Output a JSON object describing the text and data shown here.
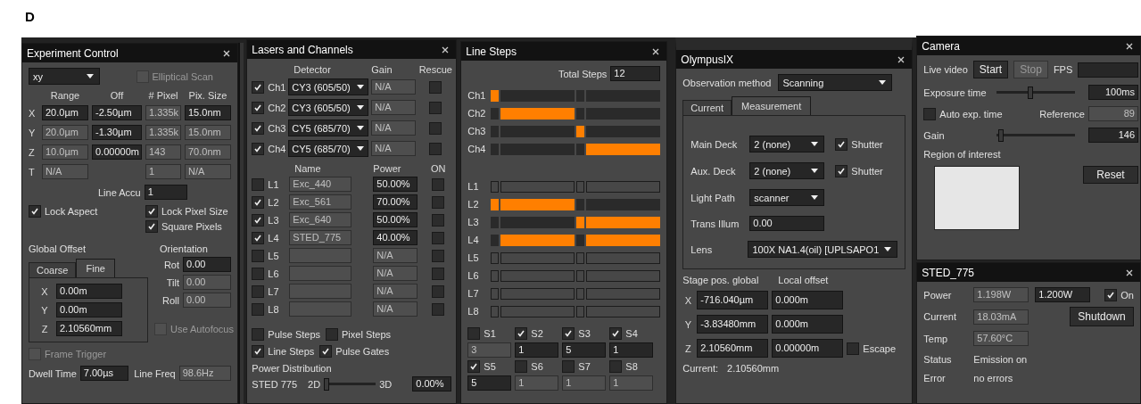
{
  "figure_label": "D",
  "experiment_control": {
    "title": "Experiment Control",
    "mode": "xy",
    "elliptical_scan": {
      "label": "Elliptical Scan",
      "checked": false,
      "disabled": true
    },
    "columns": [
      "Range",
      "Off",
      "# Pixel",
      "Pix. Size"
    ],
    "rows": [
      {
        "axis": "X",
        "cells": [
          {
            "value": "20.0µm",
            "disabled": false
          },
          {
            "value": "-2.50µm",
            "disabled": false
          },
          {
            "value": "1.335k",
            "disabled": true
          },
          {
            "value": "15.0nm",
            "disabled": false
          }
        ]
      },
      {
        "axis": "Y",
        "cells": [
          {
            "value": "20.0µm",
            "disabled": true
          },
          {
            "value": "-1.30µm",
            "disabled": false
          },
          {
            "value": "1.335k",
            "disabled": true
          },
          {
            "value": "15.0nm",
            "disabled": true
          }
        ]
      },
      {
        "axis": "Z",
        "cells": [
          {
            "value": "10.0µm",
            "disabled": true
          },
          {
            "value": "0.00000m",
            "disabled": false
          },
          {
            "value": "143",
            "disabled": true
          },
          {
            "value": "70.0nm",
            "disabled": true
          }
        ]
      },
      {
        "axis": "T",
        "cells": [
          {
            "value": "N/A",
            "disabled": true
          },
          null,
          {
            "value": "1",
            "disabled": true
          },
          {
            "value": "N/A",
            "disabled": true
          }
        ]
      }
    ],
    "line_accu": {
      "label": "Line Accu",
      "value": "1"
    },
    "lock_aspect": {
      "label": "Lock Aspect",
      "checked": true,
      "disabled": false
    },
    "lock_pixel_size": {
      "label": "Lock Pixel Size",
      "checked": true,
      "disabled": false
    },
    "square_pixels": {
      "label": "Square Pixels",
      "checked": true,
      "disabled": false
    },
    "global_offset": {
      "label": "Global Offset",
      "tabs": [
        {
          "label": "Coarse",
          "selected": false
        },
        {
          "label": "Fine",
          "selected": true
        }
      ],
      "rows": [
        {
          "axis": "X",
          "value": "0.00m"
        },
        {
          "axis": "Y",
          "value": "0.00m"
        },
        {
          "axis": "Z",
          "value": "2.10560mm"
        }
      ]
    },
    "orientation": {
      "label": "Orientation",
      "rows": [
        {
          "label": "Rot",
          "value": "0.00",
          "disabled": false
        },
        {
          "label": "Tilt",
          "value": "0.00",
          "disabled": true
        },
        {
          "label": "Roll",
          "value": "0.00",
          "disabled": true
        }
      ]
    },
    "use_autofocus": {
      "label": "Use Autofocus",
      "checked": false,
      "disabled": true
    },
    "frame_trigger": {
      "label": "Frame Trigger",
      "checked": false,
      "disabled": true
    },
    "dwell_time": {
      "label": "Dwell Time",
      "value": "7.00µs",
      "disabled": false
    },
    "line_freq": {
      "label": "Line Freq",
      "value": "98.6Hz",
      "disabled": true
    }
  },
  "lasers_channels": {
    "title": "Lasers and Channels",
    "channel_columns": [
      "Detector",
      "Gain",
      "Rescue"
    ],
    "channels": [
      {
        "label": "Ch1",
        "checked": true,
        "detector": "CY3 (605/50)",
        "gain": {
          "value": "N/A",
          "disabled": true
        },
        "rescue": false
      },
      {
        "label": "Ch2",
        "checked": true,
        "detector": "CY3 (605/50)",
        "gain": {
          "value": "N/A",
          "disabled": true
        },
        "rescue": false
      },
      {
        "label": "Ch3",
        "checked": true,
        "detector": "CY5 (685/70)",
        "gain": {
          "value": "N/A",
          "disabled": true
        },
        "rescue": false
      },
      {
        "label": "Ch4",
        "checked": true,
        "detector": "CY5 (685/70)",
        "gain": {
          "value": "N/A",
          "disabled": true
        },
        "rescue": false
      }
    ],
    "laser_columns": [
      "Name",
      "Power",
      "ON"
    ],
    "lasers": [
      {
        "label": "L1",
        "checked": false,
        "name": {
          "value": "Exc_440",
          "disabled": true
        },
        "power": {
          "value": "50.00%",
          "disabled": false
        },
        "on": false
      },
      {
        "label": "L2",
        "checked": true,
        "name": {
          "value": "Exc_561",
          "disabled": true
        },
        "power": {
          "value": "70.00%",
          "disabled": false
        },
        "on": false
      },
      {
        "label": "L3",
        "checked": true,
        "name": {
          "value": "Exc_640",
          "disabled": true
        },
        "power": {
          "value": "50.00%",
          "disabled": false
        },
        "on": false
      },
      {
        "label": "L4",
        "checked": true,
        "name": {
          "value": "STED_775",
          "disabled": true
        },
        "power": {
          "value": "40.00%",
          "disabled": false
        },
        "on": false
      },
      {
        "label": "L5",
        "checked": false,
        "name": {
          "disabled": true
        },
        "power": {
          "value": "N/A",
          "disabled": true
        },
        "on": false
      },
      {
        "label": "L6",
        "checked": false,
        "name": {
          "disabled": true
        },
        "power": {
          "value": "N/A",
          "disabled": true
        },
        "on": false
      },
      {
        "label": "L7",
        "checked": false,
        "name": {
          "disabled": true
        },
        "power": {
          "value": "N/A",
          "disabled": true
        },
        "on": false
      },
      {
        "label": "L8",
        "checked": false,
        "name": {
          "disabled": true
        },
        "power": {
          "value": "N/A",
          "disabled": true
        },
        "on": false
      }
    ],
    "options": [
      {
        "label": "Pulse Steps",
        "checked": false
      },
      {
        "label": "Pixel Steps",
        "checked": false
      },
      {
        "label": "Line Steps",
        "checked": true
      },
      {
        "label": "Pulse Gates",
        "checked": true
      }
    ],
    "power_distribution": {
      "label": "Power Distribution",
      "laser": "STED 775",
      "left": "2D",
      "right": "3D",
      "level": 0,
      "value": "0.00%"
    }
  },
  "line_steps": {
    "title": "Line Steps",
    "total_steps": {
      "label": "Total Steps",
      "value": "12"
    },
    "rows": [
      {
        "label": "Ch1",
        "active": true,
        "segments": [
          true,
          false,
          false,
          false
        ]
      },
      {
        "label": "Ch2",
        "active": true,
        "segments": [
          false,
          true,
          false,
          false
        ]
      },
      {
        "label": "Ch3",
        "active": true,
        "segments": [
          false,
          false,
          true,
          false
        ]
      },
      {
        "label": "Ch4",
        "active": true,
        "segments": [
          false,
          false,
          false,
          true
        ]
      },
      {
        "label": "L1",
        "active": false,
        "segments": [
          false,
          false,
          false,
          false
        ]
      },
      {
        "label": "L2",
        "active": true,
        "segments": [
          true,
          true,
          false,
          false
        ]
      },
      {
        "label": "L3",
        "active": true,
        "segments": [
          false,
          false,
          true,
          true
        ]
      },
      {
        "label": "L4",
        "active": true,
        "segments": [
          false,
          true,
          false,
          true
        ]
      },
      {
        "label": "L5",
        "active": false,
        "segments": [
          false,
          false,
          false,
          false
        ]
      },
      {
        "label": "L6",
        "active": false,
        "segments": [
          false,
          false,
          false,
          false
        ]
      },
      {
        "label": "L7",
        "active": false,
        "segments": [
          false,
          false,
          false,
          false
        ]
      },
      {
        "label": "L8",
        "active": false,
        "segments": [
          false,
          false,
          false,
          false
        ]
      }
    ],
    "steps": [
      {
        "label": "S1",
        "checked": false,
        "field": {
          "value": "3",
          "disabled": true
        }
      },
      {
        "label": "S2",
        "checked": true,
        "field": {
          "value": "1",
          "disabled": false
        }
      },
      {
        "label": "S3",
        "checked": true,
        "field": {
          "value": "5",
          "disabled": false
        }
      },
      {
        "label": "S4",
        "checked": true,
        "field": {
          "value": "1",
          "disabled": false
        }
      },
      {
        "label": "S5",
        "checked": true,
        "field": {
          "value": "5",
          "disabled": false
        }
      },
      {
        "label": "S6",
        "checked": false,
        "field": {
          "value": "1",
          "disabled": true
        }
      },
      {
        "label": "S7",
        "checked": false,
        "field": {
          "value": "1",
          "disabled": true
        }
      },
      {
        "label": "S8",
        "checked": false,
        "field": {
          "value": "1",
          "disabled": true
        }
      }
    ]
  },
  "olympus": {
    "title": "OlympusIX",
    "observation": {
      "label": "Observation method",
      "value": "Scanning"
    },
    "tabs": [
      {
        "label": "Current",
        "selected": false
      },
      {
        "label": "Measurement",
        "selected": true
      }
    ],
    "decks": [
      {
        "label": "Main Deck",
        "value": "2 (none)",
        "shutter": {
          "label": "Shutter",
          "checked": true
        }
      },
      {
        "label": "Aux. Deck",
        "value": "2 (none)",
        "shutter": {
          "label": "Shutter",
          "checked": true
        }
      }
    ],
    "light_path": {
      "label": "Light Path",
      "value": "scanner"
    },
    "trans_illum": {
      "label": "Trans Illum",
      "value": "0.00"
    },
    "lens": {
      "label": "Lens",
      "value": "100X NA1.4(oil) [UPLSAPO1"
    },
    "stage_header": "Stage pos. global",
    "offset_header": "Local offset",
    "stage_rows": [
      {
        "axis": "X",
        "global": "-716.040µm",
        "local": "0.000m"
      },
      {
        "axis": "Y",
        "global": "-3.83480mm",
        "local": "0.000m"
      },
      {
        "axis": "Z",
        "global": "2.10560mm",
        "local": "0.00000m"
      }
    ],
    "escape": {
      "label": "Escape",
      "checked": false
    },
    "current": {
      "label": "Current:",
      "value": "2.10560mm"
    }
  },
  "camera": {
    "title": "Camera",
    "live_video": "Live video",
    "buttons": [
      {
        "label": "Start",
        "disabled": false
      },
      {
        "label": "Stop",
        "disabled": true
      }
    ],
    "fps": "FPS",
    "exposure": {
      "label": "Exposure time",
      "level": 0.42,
      "value": "100ms"
    },
    "auto_exp": {
      "label": "Auto exp. time",
      "checked": false
    },
    "reference": {
      "label": "Reference",
      "value": "89"
    },
    "gain": {
      "label": "Gain",
      "level": 0.02,
      "value": "146"
    },
    "roi": "Region of interest",
    "reset": "Reset"
  },
  "sted": {
    "title": "STED_775",
    "power": {
      "label": "Power",
      "measured": "1.198W",
      "set": "1.200W"
    },
    "on": {
      "label": "On",
      "checked": true
    },
    "current": {
      "label": "Current",
      "value": "18.03mA"
    },
    "shutdown": "Shutdown",
    "temp": {
      "label": "Temp",
      "value": "57.60°C"
    },
    "status": {
      "label": "Status",
      "value": "Emission on"
    },
    "error": {
      "label": "Error",
      "value": "no errors"
    }
  }
}
